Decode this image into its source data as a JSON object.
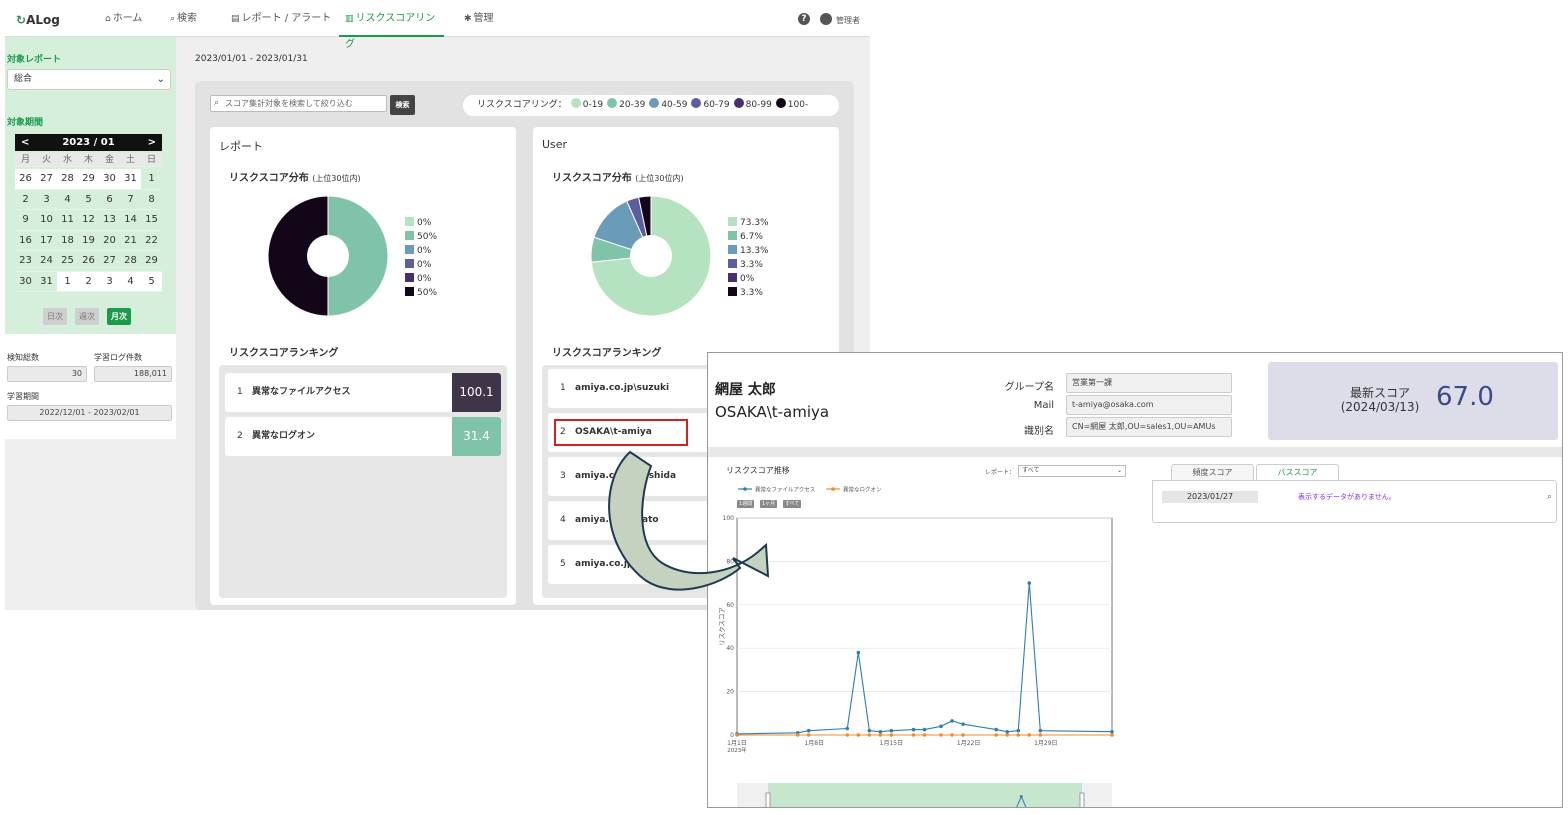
{
  "app": {
    "logo": "ALog",
    "nav": [
      {
        "icon": "home-icon",
        "glyph": "⌂",
        "label": "ホーム"
      },
      {
        "icon": "search-icon",
        "glyph": "⌕",
        "label": "検索"
      },
      {
        "icon": "report-icon",
        "glyph": "▤",
        "label": "レポート / アラート"
      },
      {
        "icon": "risk-scoring-icon",
        "glyph": "▥",
        "label": "リスクスコアリング"
      },
      {
        "icon": "gear-icon",
        "glyph": "✱",
        "label": "管理"
      }
    ],
    "help_glyph": "?",
    "user_label": "管理者"
  },
  "sidebar": {
    "target_report_label": "対象レポート",
    "target_report_value": "総合",
    "target_period_label": "対象期間",
    "calendar": {
      "month_label": "2023 / 01",
      "prev_glyph": "<",
      "next_glyph": ">",
      "weekdays": [
        "月",
        "火",
        "水",
        "木",
        "金",
        "土",
        "日"
      ],
      "weeks": [
        [
          "26",
          "27",
          "28",
          "29",
          "30",
          "31",
          "1"
        ],
        [
          "2",
          "3",
          "4",
          "5",
          "6",
          "7",
          "8"
        ],
        [
          "9",
          "10",
          "11",
          "12",
          "13",
          "14",
          "15"
        ],
        [
          "16",
          "17",
          "18",
          "19",
          "20",
          "21",
          "22"
        ],
        [
          "23",
          "24",
          "25",
          "26",
          "27",
          "28",
          "29"
        ],
        [
          "30",
          "31",
          "1",
          "2",
          "3",
          "4",
          "5"
        ]
      ]
    },
    "period_buttons": [
      "日次",
      "週次",
      "月次"
    ],
    "detect_total_label": "検知総数",
    "detect_total_value": "30",
    "learn_log_label": "学習ログ件数",
    "learn_log_value": "188,011",
    "learn_period_label": "学習期間",
    "learn_period_value": "2022/12/01 - 2023/02/01"
  },
  "main": {
    "period": "2023/01/01 - 2023/01/31",
    "search_placeholder": "スコア集計対象を検索して絞り込む",
    "search_button": "検索",
    "legend_label": "リスクスコアリング：",
    "legend": [
      {
        "label": "0-19",
        "color": "#b5e3c1"
      },
      {
        "label": "20-39",
        "color": "#7fc4a8"
      },
      {
        "label": "40-59",
        "color": "#6a9bb8"
      },
      {
        "label": "60-79",
        "color": "#5e5e9e"
      },
      {
        "label": "80-99",
        "color": "#4a2f6e"
      },
      {
        "label": "100-",
        "color": "#120618"
      }
    ],
    "report_card": {
      "title": "レポート",
      "dist_title": "リスクスコア分布",
      "dist_sub": "(上位30位内)",
      "pie_values": [
        0,
        50,
        0,
        0,
        0,
        50
      ],
      "pie_labels": [
        "0%",
        "50%",
        "0%",
        "0%",
        "0%",
        "50%"
      ],
      "ranking_title": "リスクスコアランキング",
      "ranking": [
        {
          "rank": "1",
          "name": "異常なファイルアクセス",
          "score": "100.1",
          "color": "#3e3548"
        },
        {
          "rank": "2",
          "name": "異常なログオン",
          "score": "31.4",
          "color": "#7fc4a8"
        }
      ]
    },
    "user_card": {
      "title": "User",
      "dist_title": "リスクスコア分布",
      "dist_sub": "(上位30位内)",
      "pie_values": [
        73.3,
        6.7,
        13.3,
        3.3,
        0,
        3.3
      ],
      "pie_labels": [
        "73.3%",
        "6.7%",
        "13.3%",
        "3.3%",
        "0%",
        "3.3%"
      ],
      "ranking_title": "リスクスコアランキング",
      "ranking": [
        {
          "rank": "1",
          "name": "amiya.co.jp\\suzuki"
        },
        {
          "rank": "2",
          "name": "OSAKA\\t-amiya"
        },
        {
          "rank": "3",
          "name": "amiya.co.jp\\yoshida"
        },
        {
          "rank": "4",
          "name": "amiya.co.jp\\sato"
        },
        {
          "rank": "5",
          "name": "amiya.co.jp\\kato"
        }
      ]
    }
  },
  "detail": {
    "name": "網屋 太郎",
    "account": "OSAKA\\t-amiya",
    "group_label": "グループ名",
    "group_value": "営業第一課",
    "mail_label": "Mail",
    "mail_value": "t-amiya@osaka.com",
    "dn_label": "識別名",
    "dn_value": "CN=網屋 太郎,OU=sales1,OU=AMUs",
    "latest_score_label": "最新スコア",
    "latest_score_date": "(2024/03/13)",
    "latest_score_value": "67.0",
    "chart_title": "リスクスコア推移",
    "report_select_label": "レポート：",
    "report_select_value": "すべて",
    "range_buttons": [
      "1週間",
      "1ヶ月",
      "すべて"
    ],
    "tabs": [
      "頻度スコア",
      "パススコア"
    ],
    "tab_date": "2023/01/27",
    "no_data_text": "表示するデータがありません。"
  },
  "chart_data": {
    "type": "line",
    "title": "",
    "ylabel": "リスクスコア",
    "xlabel": "",
    "ylim": [
      0,
      100
    ],
    "yticks": [
      0,
      20,
      40,
      60,
      80,
      100
    ],
    "xticks": [
      {
        "day": 1,
        "label": "1月1日",
        "sub": "2023年"
      },
      {
        "day": 8,
        "label": "1月8日"
      },
      {
        "day": 15,
        "label": "1月15日"
      },
      {
        "day": 22,
        "label": "1月22日"
      },
      {
        "day": 29,
        "label": "1月29日"
      }
    ],
    "x_range_days": [
      1,
      35
    ],
    "series": [
      {
        "name": "異常なファイルアクセス",
        "color": "#2e7fb0",
        "points": [
          [
            1,
            0.5
          ],
          [
            6.5,
            1
          ],
          [
            7.5,
            2
          ],
          [
            11,
            3
          ],
          [
            12,
            38
          ],
          [
            13,
            2
          ],
          [
            14,
            1.5
          ],
          [
            15,
            2
          ],
          [
            17,
            2.5
          ],
          [
            18,
            2.5
          ],
          [
            19.5,
            4
          ],
          [
            20.5,
            6.5
          ],
          [
            21.5,
            5
          ],
          [
            24.5,
            2.5
          ],
          [
            25.5,
            1.5
          ],
          [
            26.5,
            2
          ],
          [
            27.5,
            70
          ],
          [
            28.5,
            2
          ],
          [
            35,
            1.5
          ]
        ]
      },
      {
        "name": "異常なログオン",
        "color": "#f28c28",
        "points": [
          [
            1,
            0
          ],
          [
            6.5,
            0
          ],
          [
            7.5,
            0
          ],
          [
            11,
            0
          ],
          [
            12,
            0
          ],
          [
            13,
            0
          ],
          [
            14,
            0
          ],
          [
            15,
            0
          ],
          [
            17,
            0
          ],
          [
            18,
            0
          ],
          [
            19.5,
            0
          ],
          [
            20.5,
            0
          ],
          [
            21.5,
            0
          ],
          [
            24.5,
            0
          ],
          [
            25.5,
            0
          ],
          [
            26.5,
            0
          ],
          [
            27.5,
            0
          ],
          [
            28.5,
            0
          ],
          [
            35,
            0
          ]
        ]
      }
    ]
  }
}
